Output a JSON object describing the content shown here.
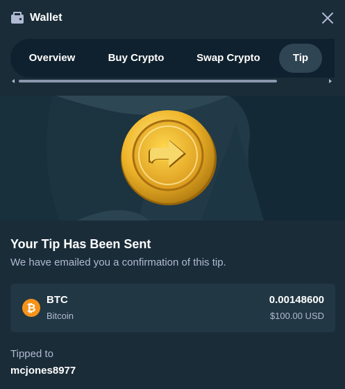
{
  "header": {
    "title": "Wallet",
    "icon": "wallet-icon",
    "close_icon": "close-icon"
  },
  "tabs": [
    {
      "label": "Overview",
      "active": false
    },
    {
      "label": "Buy Crypto",
      "active": false
    },
    {
      "label": "Swap Crypto",
      "active": false
    },
    {
      "label": "Tip",
      "active": true
    }
  ],
  "confirmation": {
    "heading": "Your Tip Has Been Sent",
    "subtext": "We have emailed you a confirmation of this tip."
  },
  "transaction": {
    "icon": "bitcoin-icon",
    "symbol": "BTC",
    "name": "Bitcoin",
    "amount": "0.00148600",
    "usd_value": "$100.00 USD"
  },
  "recipient": {
    "label": "Tipped to",
    "username": "mcjones8977"
  },
  "colors": {
    "background": "#1a2c38",
    "tab_bar": "#0f212e",
    "active_tab": "#2f4553",
    "card": "#213743",
    "muted_text": "#b1bad3",
    "bitcoin": "#f7931a",
    "coin_gold": "#f5c542"
  }
}
